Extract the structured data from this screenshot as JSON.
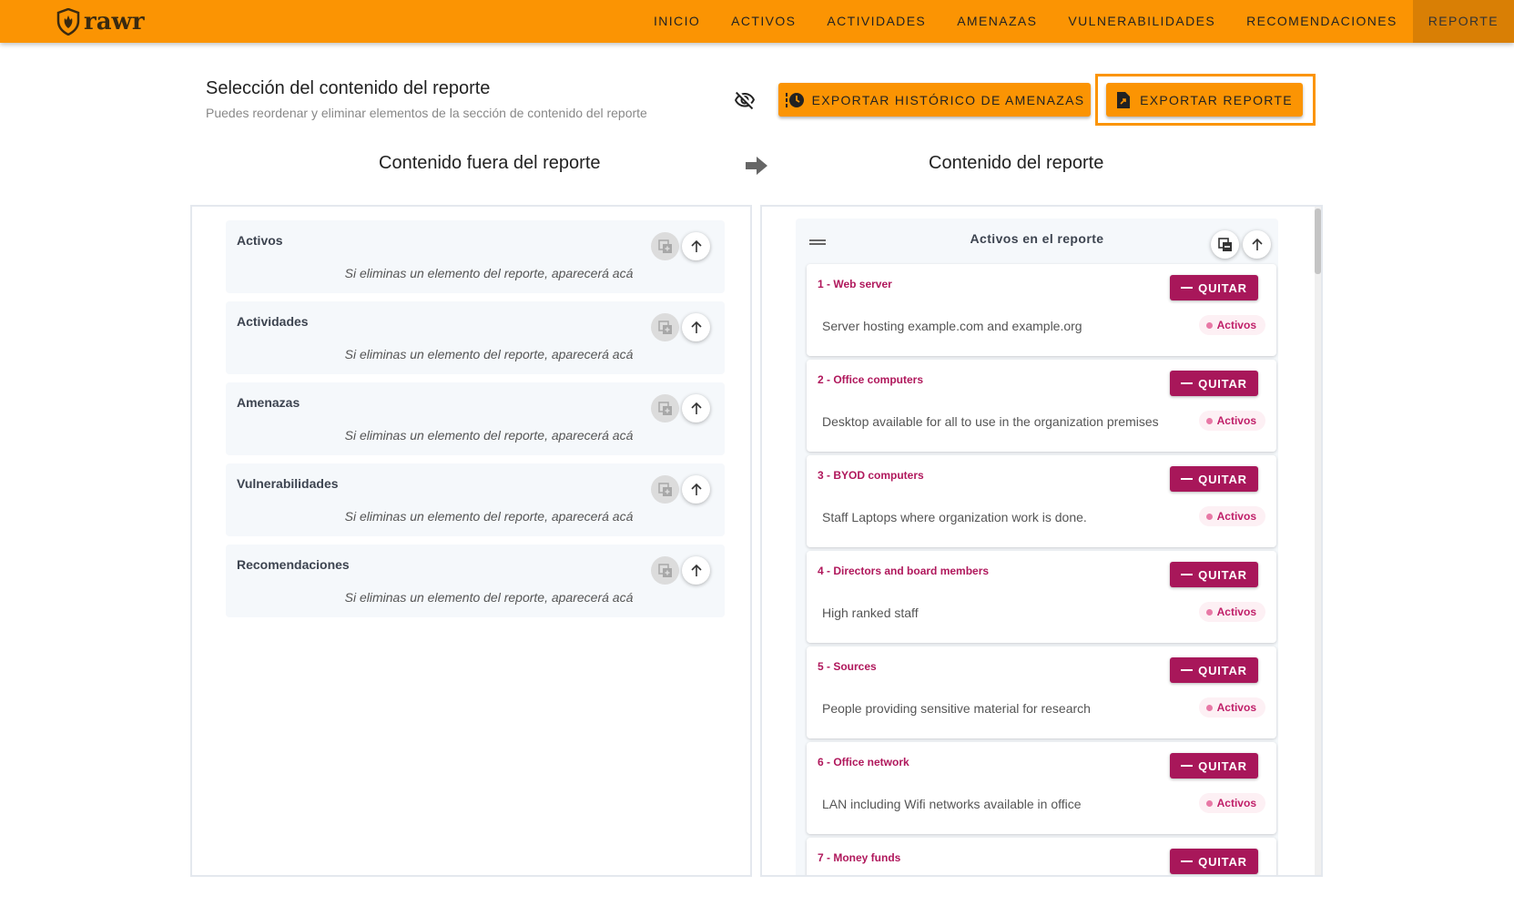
{
  "header": {
    "logo_text": "rawr",
    "nav": [
      "INICIO",
      "ACTIVOS",
      "ACTIVIDADES",
      "AMENAZAS",
      "VULNERABILIDADES",
      "RECOMENDACIONES",
      "REPORTE"
    ],
    "active_nav": "REPORTE"
  },
  "selection": {
    "title": "Selección del contenido del reporte",
    "subtitle": "Puedes reordenar y eliminar elementos de la sección de contenido del reporte",
    "export_history_label": "EXPORTAR HISTÓRICO DE AMENAZAS",
    "export_report_label": "EXPORTAR REPORTE"
  },
  "columns": {
    "left_title": "Contenido fuera del reporte",
    "right_title": "Contenido del reporte"
  },
  "left_sections": [
    {
      "title": "Activos",
      "note": "Si eliminas un elemento del reporte, aparecerá acá"
    },
    {
      "title": "Actividades",
      "note": "Si eliminas un elemento del reporte, aparecerá acá"
    },
    {
      "title": "Amenazas",
      "note": "Si eliminas un elemento del reporte, aparecerá acá"
    },
    {
      "title": "Vulnerabilidades",
      "note": "Si eliminas un elemento del reporte, aparecerá acá"
    },
    {
      "title": "Recomendaciones",
      "note": "Si eliminas un elemento del reporte, aparecerá acá"
    }
  ],
  "right_group": {
    "title": "Activos en el reporte",
    "remove_label": "QUITAR",
    "badge_label": "Activos",
    "items": [
      {
        "title": "1 - Web server",
        "desc": "Server hosting example.com and example.org"
      },
      {
        "title": "2 - Office computers",
        "desc": "Desktop available for all to use in the organization premises"
      },
      {
        "title": "3 - BYOD computers",
        "desc": "Staff Laptops where organization work is done."
      },
      {
        "title": "4 - Directors and board members",
        "desc": "High ranked staff"
      },
      {
        "title": "5 - Sources",
        "desc": "People providing sensitive material for research"
      },
      {
        "title": "6 - Office network",
        "desc": "LAN including Wifi networks available in office"
      },
      {
        "title": "7 - Money funds",
        "desc": ""
      }
    ]
  },
  "colors": {
    "accent": "#fb9403",
    "accent_dark": "#d97f05",
    "danger": "#a8175a",
    "item_title": "#b0185c"
  }
}
